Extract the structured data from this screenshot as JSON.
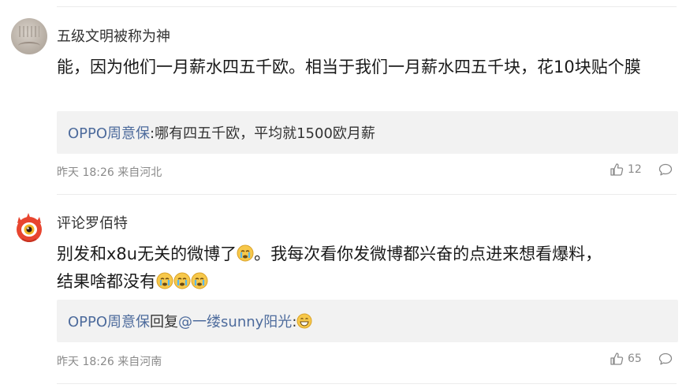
{
  "comments": [
    {
      "username": "五级文明被称为神",
      "content": "能，因为他们一月薪水四五千欧。相当于我们一月薪水四五千块，花10块贴个膜",
      "reply": {
        "user": "OPPO周意保",
        "text": ":哪有四五千欧，平均就1500欧月薪"
      },
      "time": "昨天 18:26",
      "location": "来自河北",
      "likes": "12",
      "avatar_icon": "user-photo-avatar"
    },
    {
      "username": "评论罗佰特",
      "content_part1": "别发和x8u无关的微博了",
      "content_part2": "。我每次看你发微博都兴奋的点进来想看爆料，",
      "content_line2": "结果啥都没有",
      "reply": {
        "user": "OPPO周意保",
        "mid": "回复",
        "mention": "@一缕sunny阳光",
        "colon": ":"
      },
      "time": "昨天 18:26",
      "location": "来自河南",
      "likes": "65",
      "avatar_icon": "weibo-eye-mascot-avatar"
    }
  ],
  "icons": {
    "like": "thumbs-up-icon",
    "comment": "comment-bubble-icon",
    "cry": "crying-emoji-icon",
    "grin": "grinning-emoji-icon"
  },
  "colors": {
    "username_link": "#4d6b9c",
    "reply_bg": "#f2f2f2",
    "meta": "#8a8a8a"
  }
}
